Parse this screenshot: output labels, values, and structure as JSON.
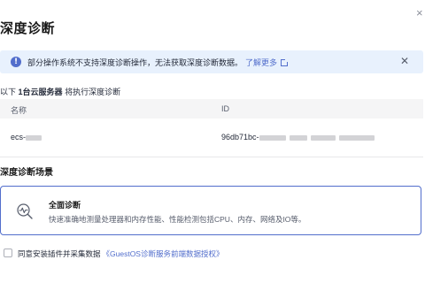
{
  "dialog": {
    "title": "深度诊断",
    "close_icon": "close-icon"
  },
  "alert": {
    "icon": "info-icon",
    "text": "部分操作系统不支持深度诊断操作，无法获取深度诊断数据。",
    "link": "了解更多",
    "close_icon": "close-icon"
  },
  "servers": {
    "prefix": "以下",
    "count_label": "1台云服务器",
    "suffix": "将执行深度诊断",
    "columns": [
      "名称",
      "ID"
    ],
    "rows": [
      {
        "name": "ecs-",
        "id": "96db71bc-"
      }
    ]
  },
  "scenario": {
    "section_title": "深度诊断场景",
    "card_title": "全面诊断",
    "card_desc": "快速准确地测量处理器和内存性能、性能检测包括CPU、内存、网络及IO等。",
    "icon": "diagnosis-magnifier-icon"
  },
  "agreement": {
    "label": "同意安装插件并采集数据",
    "link": "《GuestOS诊断服务前端数据授权》"
  },
  "colors": {
    "accent": "#526ecc",
    "alert_bg": "#e8f1fd",
    "header_bg": "#f5f5f6"
  }
}
